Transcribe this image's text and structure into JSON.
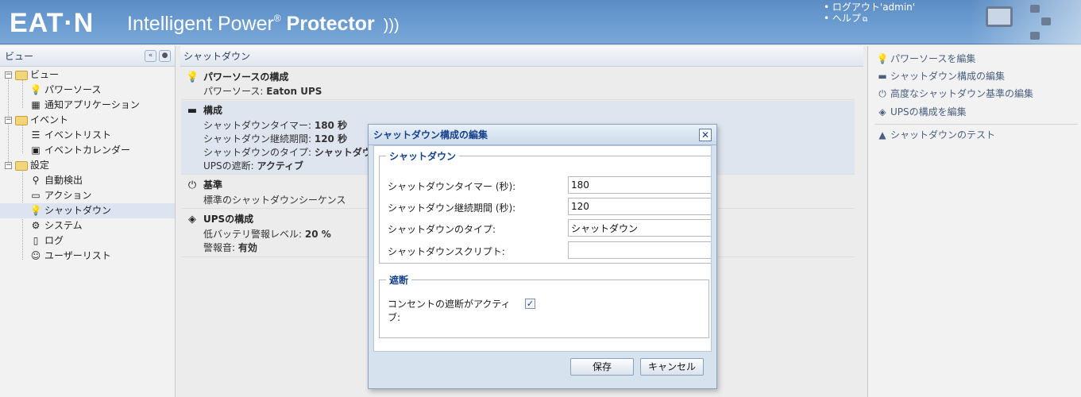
{
  "header": {
    "logo": "EAT·N",
    "app_name_part1": "Intelligent Power",
    "app_name_reg": "®",
    "app_name_part2": "Protector",
    "logout_link": "• ログアウト'admin'",
    "help_link": "• ヘルプ"
  },
  "left": {
    "title": "ビュー",
    "items": [
      {
        "label": "ビュー",
        "icon": "folder-icon"
      },
      {
        "label": "パワーソース",
        "icon": "lightbulb-icon"
      },
      {
        "label": "通知アプリケーション",
        "icon": "grid-icon"
      },
      {
        "label": "イベント",
        "icon": "folder-icon"
      },
      {
        "label": "イベントリスト",
        "icon": "list-icon"
      },
      {
        "label": "イベントカレンダー",
        "icon": "calendar-icon"
      },
      {
        "label": "設定",
        "icon": "folder-icon"
      },
      {
        "label": "自動検出",
        "icon": "search-icon"
      },
      {
        "label": "アクション",
        "icon": "window-icon"
      },
      {
        "label": "シャットダウン",
        "icon": "lightbulb-icon"
      },
      {
        "label": "システム",
        "icon": "gear-icon"
      },
      {
        "label": "ログ",
        "icon": "document-icon"
      },
      {
        "label": "ユーザーリスト",
        "icon": "users-icon"
      }
    ]
  },
  "center": {
    "title": "シャットダウン",
    "sections": [
      {
        "title": "パワーソースの構成",
        "lines": [
          {
            "label": "パワーソース: ",
            "value": "Eaton UPS"
          }
        ]
      },
      {
        "title": "構成",
        "lines": [
          {
            "label": "シャットダウンタイマー: ",
            "value": "180 秒"
          },
          {
            "label": "シャットダウン継続期間: ",
            "value": "120 秒"
          },
          {
            "label": "シャットダウンのタイプ: ",
            "value": "シャットダウン"
          },
          {
            "label": "UPSの遮断: ",
            "value": "アクティブ"
          }
        ]
      },
      {
        "title": "基準",
        "lines": [
          {
            "label": "標準のシャットダウンシーケンス",
            "value": ""
          }
        ]
      },
      {
        "title": "UPSの構成",
        "lines": [
          {
            "label": "低バッテリ警報レベル: ",
            "value": "20 %"
          },
          {
            "label": "警報音: ",
            "value": "有効"
          }
        ]
      }
    ]
  },
  "right": {
    "actions": [
      "パワーソースを編集",
      "シャットダウン構成の編集",
      "高度なシャットダウン基準の編集",
      "UPSの構成を編集",
      "シャットダウンのテスト"
    ]
  },
  "dialog": {
    "title": "シャットダウン構成の編集",
    "close": "✕",
    "group1": {
      "legend": "シャットダウン",
      "timer_label": "シャットダウンタイマー (秒):",
      "timer_value": "180",
      "duration_label": "シャットダウン継続期間 (秒):",
      "duration_value": "120",
      "type_label": "シャットダウンのタイプ:",
      "type_value": "シャットダウン",
      "script_label": "シャットダウンスクリプト:",
      "script_value": ""
    },
    "group2": {
      "legend": "遮断",
      "outlet_label_1": "コンセントの遮断がアクティ",
      "outlet_label_2": "ブ:",
      "outlet_checked": "✓"
    },
    "save": "保存",
    "cancel": "キャンセル"
  }
}
